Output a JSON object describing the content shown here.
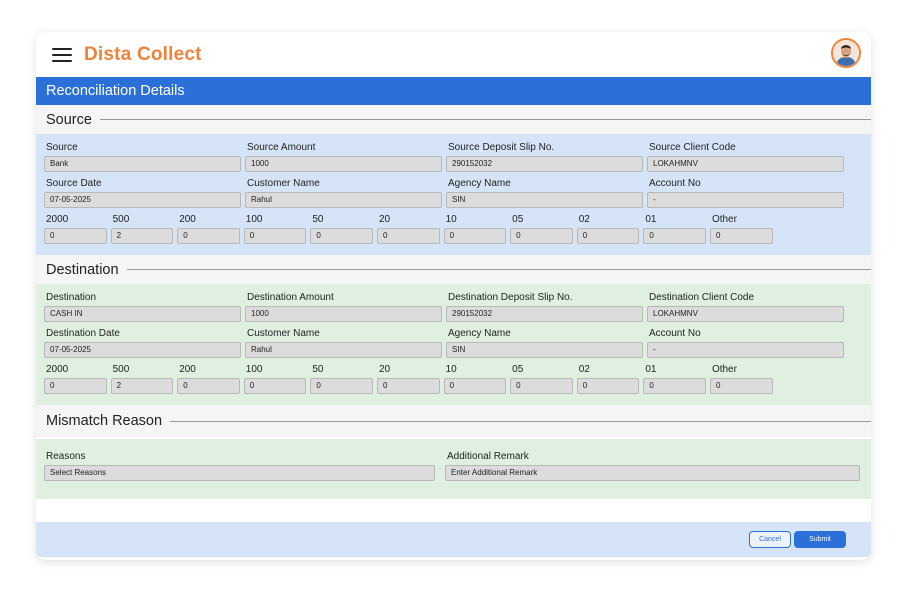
{
  "app": {
    "brand": "Dista Collect"
  },
  "page": {
    "title": "Reconciliation Details"
  },
  "source": {
    "heading": "Source",
    "fields": [
      {
        "label": "Source",
        "value": "Bank"
      },
      {
        "label": "Source Amount",
        "value": "1000"
      },
      {
        "label": "Source Deposit Slip No.",
        "value": "290152032"
      },
      {
        "label": "Source Client Code",
        "value": "LOKAHMNV"
      },
      {
        "label": "Source Date",
        "value": "07-05-2025"
      },
      {
        "label": "Customer Name",
        "value": "Rahul"
      },
      {
        "label": "Agency Name",
        "value": "SIN"
      },
      {
        "label": "Account No",
        "value": "-"
      }
    ],
    "denoms": [
      {
        "label": "2000",
        "value": "0"
      },
      {
        "label": "500",
        "value": "2"
      },
      {
        "label": "200",
        "value": "0"
      },
      {
        "label": "100",
        "value": "0"
      },
      {
        "label": "50",
        "value": "0"
      },
      {
        "label": "20",
        "value": "0"
      },
      {
        "label": "10",
        "value": "0"
      },
      {
        "label": "05",
        "value": "0"
      },
      {
        "label": "02",
        "value": "0"
      },
      {
        "label": "01",
        "value": "0"
      },
      {
        "label": "Other",
        "value": "0"
      }
    ]
  },
  "destination": {
    "heading": "Destination",
    "fields": [
      {
        "label": "Destination",
        "value": "CASH IN"
      },
      {
        "label": "Destination Amount",
        "value": "1000"
      },
      {
        "label": "Destination Deposit Slip No.",
        "value": "290152032"
      },
      {
        "label": "Destination Client Code",
        "value": "LOKAHMNV"
      },
      {
        "label": "Destination Date",
        "value": "07-05-2025"
      },
      {
        "label": "Customer Name",
        "value": "Rahul"
      },
      {
        "label": "Agency Name",
        "value": "SIN"
      },
      {
        "label": "Account No",
        "value": "-"
      }
    ],
    "denoms": [
      {
        "label": "2000",
        "value": "0"
      },
      {
        "label": "500",
        "value": "2"
      },
      {
        "label": "200",
        "value": "0"
      },
      {
        "label": "100",
        "value": "0"
      },
      {
        "label": "50",
        "value": "0"
      },
      {
        "label": "20",
        "value": "0"
      },
      {
        "label": "10",
        "value": "0"
      },
      {
        "label": "05",
        "value": "0"
      },
      {
        "label": "02",
        "value": "0"
      },
      {
        "label": "01",
        "value": "0"
      },
      {
        "label": "Other",
        "value": "0"
      }
    ]
  },
  "mismatch": {
    "heading": "Mismatch Reason",
    "reasons_label": "Reasons",
    "reasons_placeholder": "Select Reasons",
    "remark_label": "Additional Remark",
    "remark_placeholder": "Enter Additional Remark"
  },
  "actions": {
    "cancel": "Cancel",
    "submit": "Submit"
  },
  "icons": {
    "menu": "hamburger-menu-icon",
    "avatar": "user-avatar"
  },
  "colors": {
    "brand": "#f0833a",
    "primary": "#2b6fd8",
    "source_panel": "#d5e4f7",
    "destination_panel": "#dff0e1"
  }
}
